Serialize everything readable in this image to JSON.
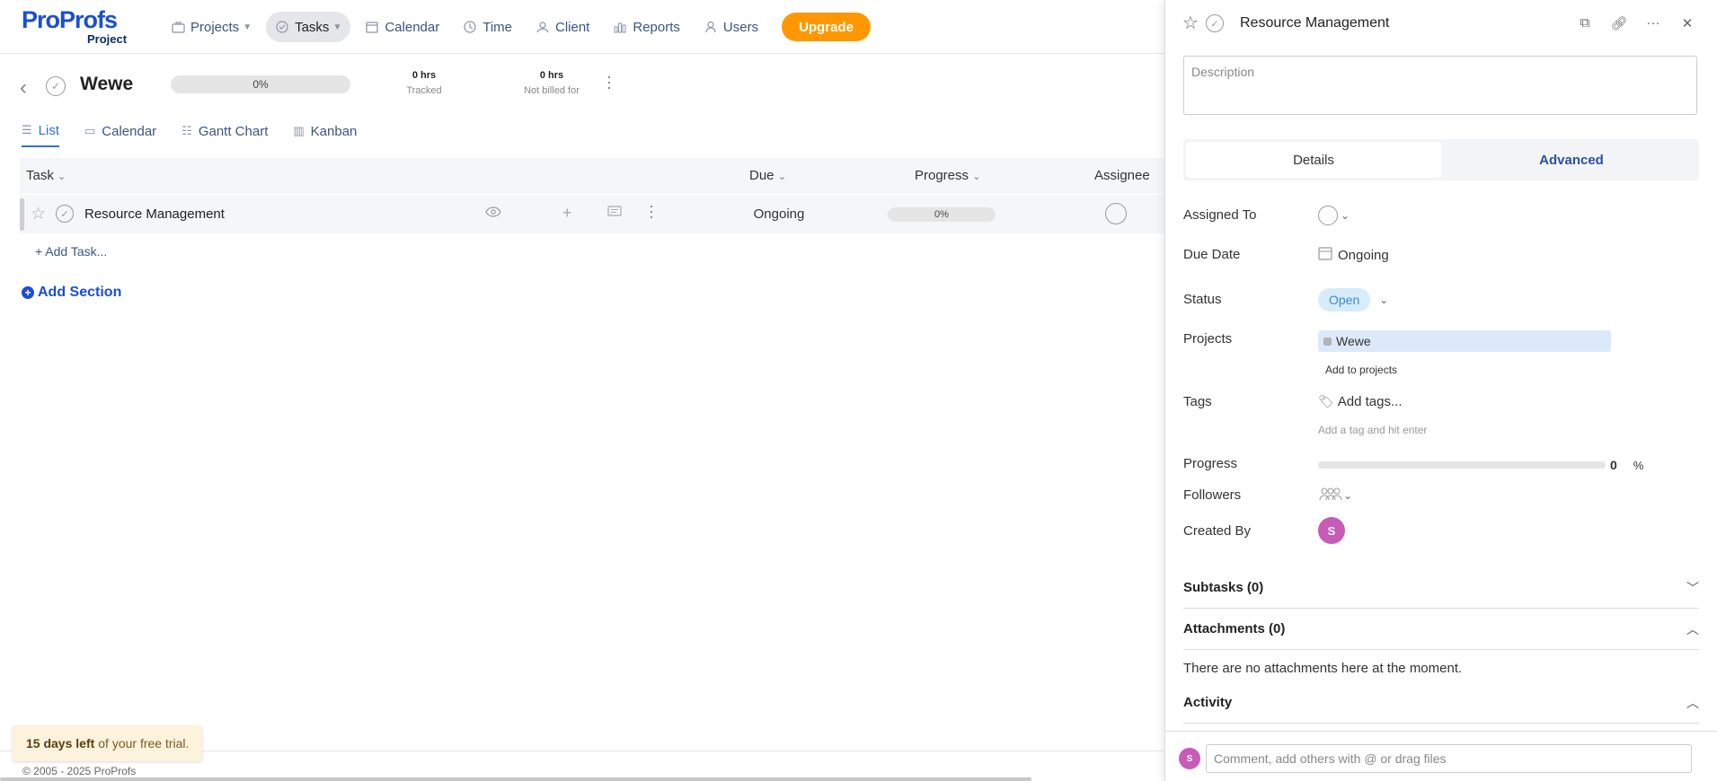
{
  "brand": {
    "name": "ProProfs",
    "sub": "Project"
  },
  "nav": {
    "items": [
      {
        "label": "Projects",
        "icon": "briefcase-icon",
        "caret": true
      },
      {
        "label": "Tasks",
        "icon": "check-circle-icon",
        "caret": true,
        "active": true
      },
      {
        "label": "Calendar",
        "icon": "calendar-icon"
      },
      {
        "label": "Time",
        "icon": "clock-icon"
      },
      {
        "label": "Client",
        "icon": "client-icon"
      },
      {
        "label": "Reports",
        "icon": "bar-chart-icon"
      },
      {
        "label": "Users",
        "icon": "user-icon"
      }
    ],
    "upgrade_label": "Upgrade"
  },
  "project": {
    "title": "Wewe",
    "progress_label": "0%",
    "progress": 0,
    "tracked_value": "0 hrs",
    "tracked_label": "Tracked",
    "notbilled_value": "0 hrs",
    "notbilled_label": "Not billed for"
  },
  "views": {
    "tabs": [
      {
        "label": "List",
        "icon": "list-icon",
        "active": true
      },
      {
        "label": "Calendar",
        "icon": "calendar-icon"
      },
      {
        "label": "Gantt Chart",
        "icon": "gantt-icon"
      },
      {
        "label": "Kanban",
        "icon": "kanban-icon"
      }
    ]
  },
  "table": {
    "headers": {
      "task": "Task",
      "due": "Due",
      "progress": "Progress",
      "assignee": "Assignee"
    },
    "rows": [
      {
        "name": "Resource Management",
        "due": "Ongoing",
        "progress_label": "0%",
        "progress": 0
      }
    ],
    "add_task": "+ Add Task...",
    "add_section": "Add Section"
  },
  "footer": {
    "trial_bold": "15 days left",
    "trial_rest": "of your free trial.",
    "copyright": "© 2005 - 2025 ProProfs"
  },
  "panel": {
    "title": "Resource Management",
    "description_placeholder": "Description",
    "tabs": {
      "details": "Details",
      "advanced": "Advanced"
    },
    "fields": {
      "assigned_to": "Assigned To",
      "due_date": "Due Date",
      "due_value": "Ongoing",
      "status": "Status",
      "status_value": "Open",
      "projects": "Projects",
      "project_value": "Wewe",
      "add_to_projects": "Add to projects",
      "tags": "Tags",
      "add_tags": "Add tags...",
      "tag_hint": "Add a tag and hit enter",
      "progress": "Progress",
      "progress_value": "0",
      "progress_unit": "%",
      "followers": "Followers",
      "created_by": "Created By",
      "creator_initial": "S"
    },
    "sections": {
      "subtasks": "Subtasks (0)",
      "attachments": "Attachments (0)",
      "no_attachments": "There are no attachments here at the moment.",
      "activity": "Activity"
    },
    "comment": {
      "avatar_initial": "S",
      "placeholder": "Comment, add others with @ or drag files"
    }
  }
}
